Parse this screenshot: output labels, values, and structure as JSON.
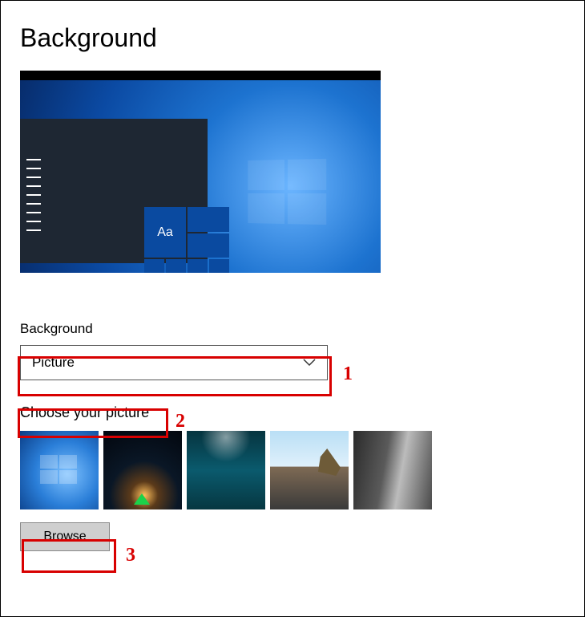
{
  "title": "Background",
  "preview": {
    "tile_text": "Aa"
  },
  "background_field": {
    "label": "Background",
    "selected": "Picture"
  },
  "choose_label": "Choose your picture",
  "thumbnails": [
    {
      "name": "default-blue-windows"
    },
    {
      "name": "night-tent"
    },
    {
      "name": "underwater"
    },
    {
      "name": "beach-rock"
    },
    {
      "name": "grey-cliff"
    }
  ],
  "browse_label": "Browse",
  "annotations": {
    "n1": "1",
    "n2": "2",
    "n3": "3"
  }
}
